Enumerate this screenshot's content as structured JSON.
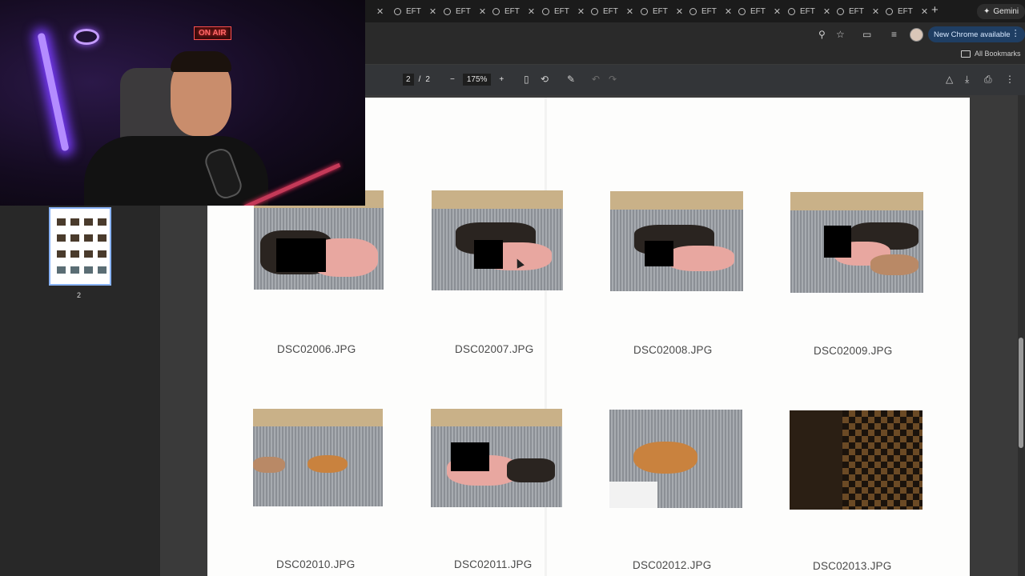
{
  "browser": {
    "tabs": [
      {
        "label": "EFT"
      },
      {
        "label": "EFT"
      },
      {
        "label": "EFT"
      },
      {
        "label": "EFT"
      },
      {
        "label": "EFT"
      },
      {
        "label": "EFT"
      },
      {
        "label": "EFT"
      },
      {
        "label": "EFT"
      },
      {
        "label": "EFT"
      },
      {
        "label": "EFT"
      },
      {
        "label": "EFT"
      },
      {
        "label": "EFT"
      }
    ],
    "gemini_label": "Gemini",
    "update_label": "New Chrome available",
    "bookmarks_label": "All Bookmarks"
  },
  "pdf_toolbar": {
    "current_page": "2",
    "separator": "/",
    "total_pages": "2",
    "zoom": "175%"
  },
  "sidebar": {
    "thumbnail_label": "2"
  },
  "webcam": {
    "sign_text": "ON AIR"
  },
  "document": {
    "images": [
      {
        "caption": "DSC02006.JPG"
      },
      {
        "caption": "DSC02007.JPG"
      },
      {
        "caption": "DSC02008.JPG"
      },
      {
        "caption": "DSC02009.JPG"
      },
      {
        "caption": "DSC02010.JPG"
      },
      {
        "caption": "DSC02011.JPG"
      },
      {
        "caption": "DSC02012.JPG"
      },
      {
        "caption": "DSC02013.JPG"
      }
    ]
  },
  "colors": {
    "update_chip_bg": "#1f3e63",
    "thumbnail_highlight": "#8ab4f8",
    "censor_block": "#000000"
  }
}
